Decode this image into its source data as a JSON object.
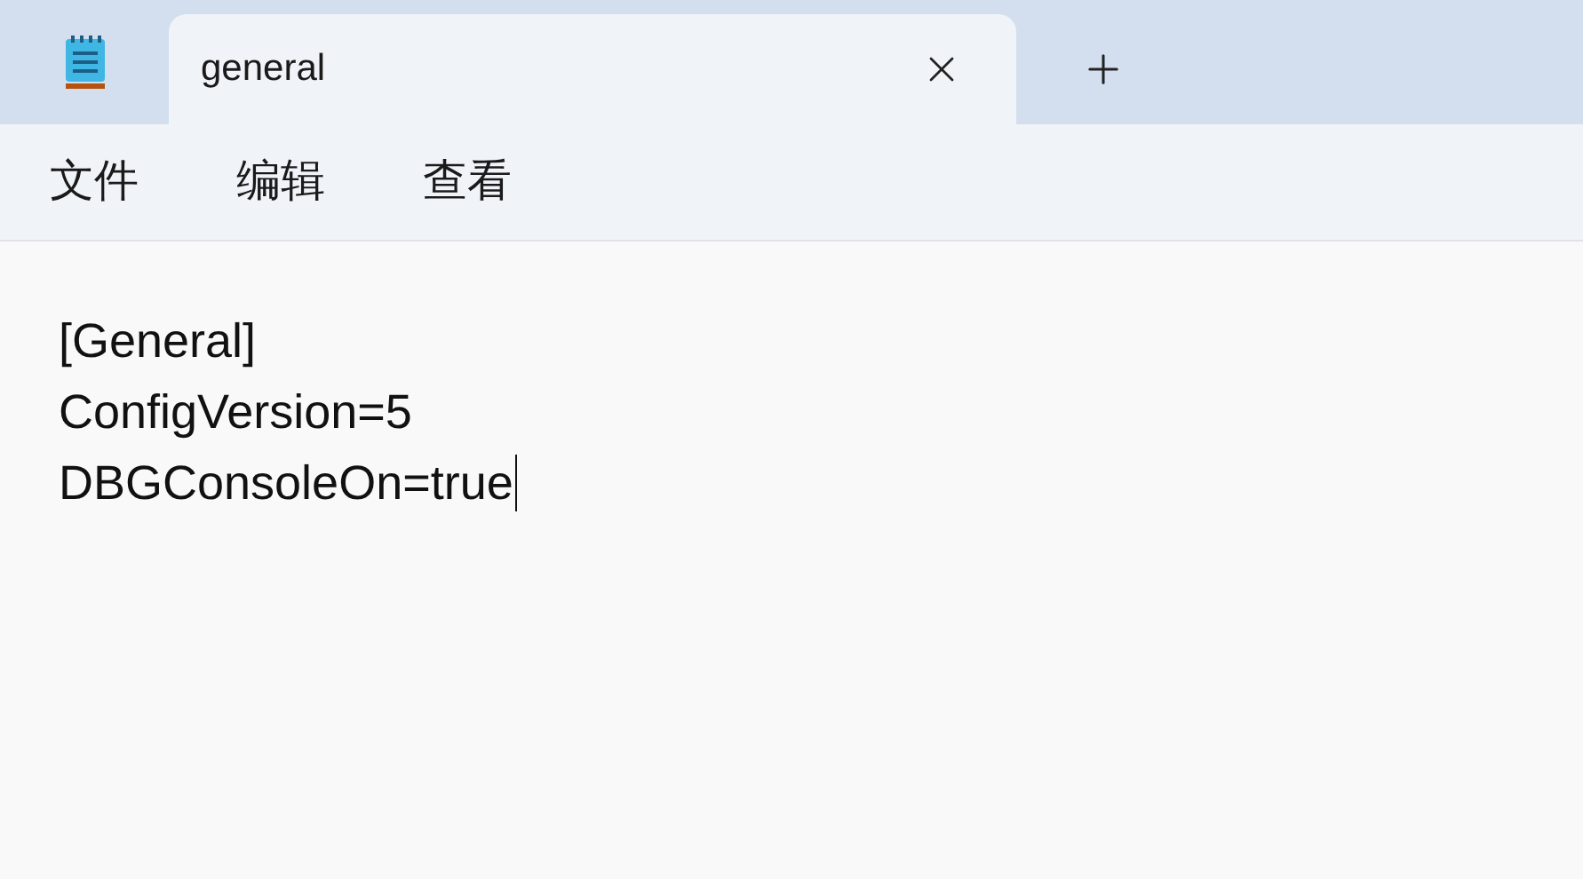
{
  "tabs": [
    {
      "title": "general",
      "selected": true
    }
  ],
  "menu": [
    {
      "label": "文件"
    },
    {
      "label": "编辑"
    },
    {
      "label": "查看"
    }
  ],
  "editor": {
    "lines": [
      "[General]",
      "ConfigVersion=5",
      "DBGConsoleOn=true"
    ]
  }
}
